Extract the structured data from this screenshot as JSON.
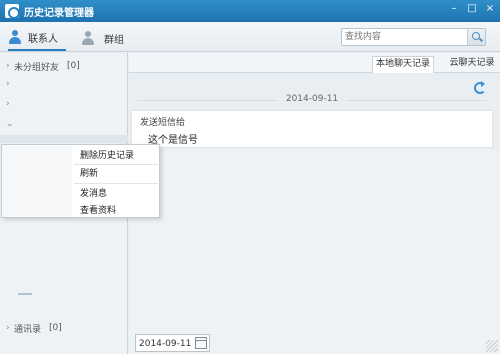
{
  "window": {
    "title": "历史记录管理器"
  },
  "toolbar": {
    "tab_contacts": "联系人",
    "tab_groups": "群组",
    "search_placeholder": "查找内容"
  },
  "left_panel": {
    "ungrouped_label": "未分组好友",
    "ungrouped_count": "[0]",
    "recent_label": "通讯录",
    "recent_count": "[0]"
  },
  "context_menu": {
    "items": [
      "删除历史记录",
      "刷新",
      "发消息",
      "查看资料"
    ]
  },
  "right_panel": {
    "tab_local": "本地聊天记录",
    "tab_cloud": "云聊天记录",
    "date_separator": "2014-09-11",
    "message": {
      "sender": "发送短信给",
      "body": "这个是信号"
    }
  },
  "bottom": {
    "date_value": "2014-09-11"
  },
  "colors": {
    "titlebar": "#1e73b0",
    "accent": "#2b7fc0"
  }
}
